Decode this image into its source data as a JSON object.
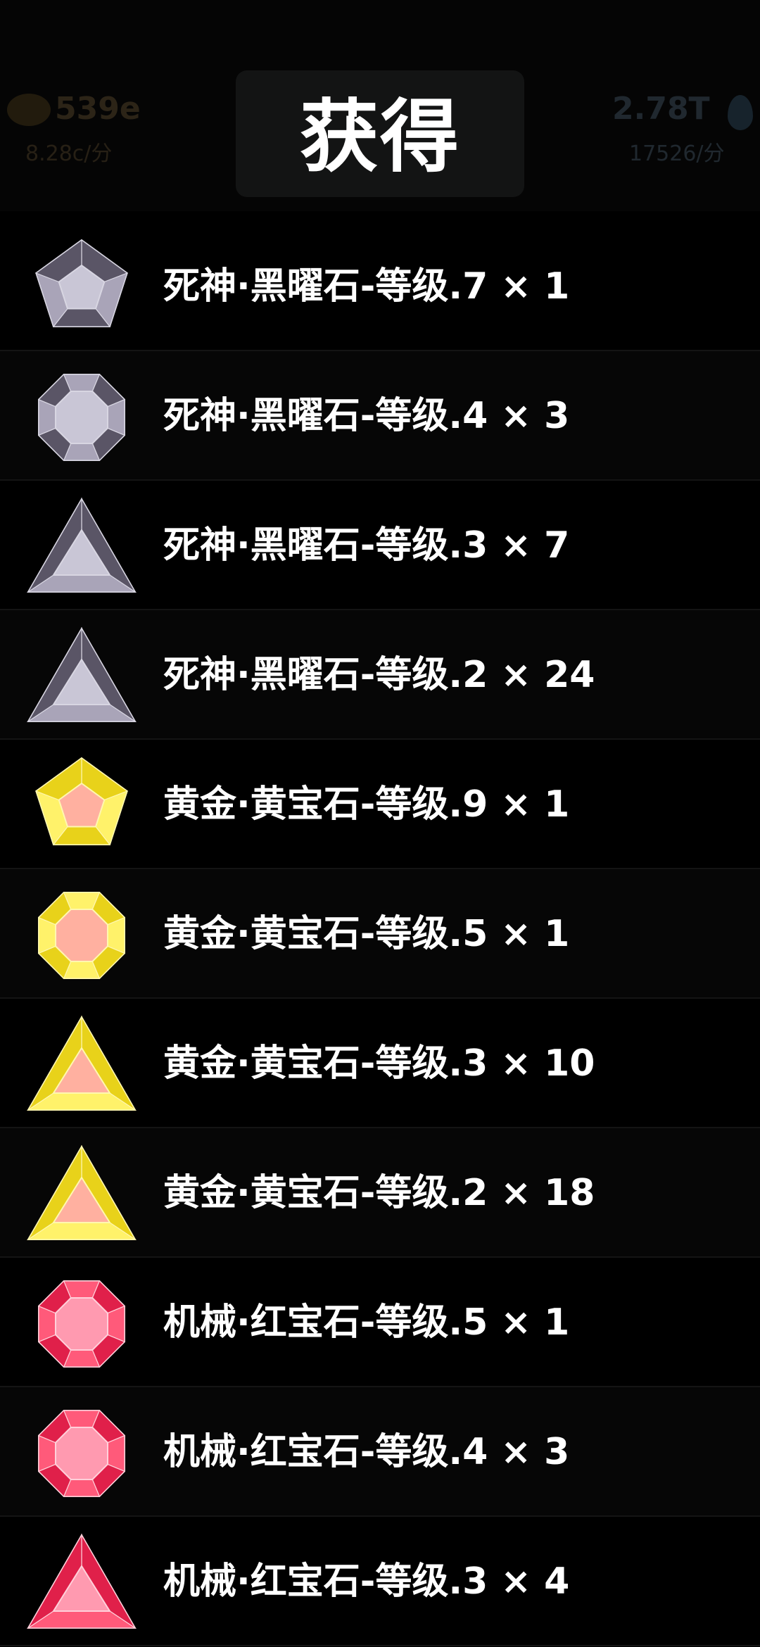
{
  "header": {
    "title": "获得",
    "resource_left": {
      "amount": "539e",
      "rate": "8.28c/分",
      "icon": "gold-coin-icon"
    },
    "resource_right": {
      "amount": "2.78T",
      "rate": "17526/分",
      "icon": "water-drop-icon"
    }
  },
  "gem_colors": {
    "obsidian": "#5a5566",
    "topaz": "#e8d21a",
    "ruby": "#e0204a"
  },
  "rewards": [
    {
      "name": "死神·黑曜石-等级.7",
      "quantity_text": "× 1",
      "gem": "obsidian",
      "shape": "pentagon",
      "icon": "obsidian-pentagon-gem-icon"
    },
    {
      "name": "死神·黑曜石-等级.4",
      "quantity_text": "× 3",
      "gem": "obsidian",
      "shape": "octagon",
      "icon": "obsidian-octagon-gem-icon"
    },
    {
      "name": "死神·黑曜石-等级.3",
      "quantity_text": "× 7",
      "gem": "obsidian",
      "shape": "triangle",
      "icon": "obsidian-triangle-gem-icon"
    },
    {
      "name": "死神·黑曜石-等级.2",
      "quantity_text": "× 24",
      "gem": "obsidian",
      "shape": "triangle",
      "icon": "obsidian-triangle-gem-icon"
    },
    {
      "name": "黄金·黄宝石-等级.9",
      "quantity_text": "× 1",
      "gem": "topaz",
      "shape": "pentagon",
      "icon": "topaz-pentagon-gem-icon"
    },
    {
      "name": "黄金·黄宝石-等级.5",
      "quantity_text": "× 1",
      "gem": "topaz",
      "shape": "octagon",
      "icon": "topaz-octagon-gem-icon"
    },
    {
      "name": "黄金·黄宝石-等级.3",
      "quantity_text": "× 10",
      "gem": "topaz",
      "shape": "triangle",
      "icon": "topaz-triangle-gem-icon"
    },
    {
      "name": "黄金·黄宝石-等级.2",
      "quantity_text": "× 18",
      "gem": "topaz",
      "shape": "triangle",
      "icon": "topaz-triangle-gem-icon"
    },
    {
      "name": "机械·红宝石-等级.5",
      "quantity_text": "× 1",
      "gem": "ruby",
      "shape": "octagon",
      "icon": "ruby-octagon-gem-icon"
    },
    {
      "name": "机械·红宝石-等级.4",
      "quantity_text": "× 3",
      "gem": "ruby",
      "shape": "octagon",
      "icon": "ruby-octagon-gem-icon"
    },
    {
      "name": "机械·红宝石-等级.3",
      "quantity_text": "× 4",
      "gem": "ruby",
      "shape": "triangle",
      "icon": "ruby-triangle-gem-icon"
    }
  ]
}
